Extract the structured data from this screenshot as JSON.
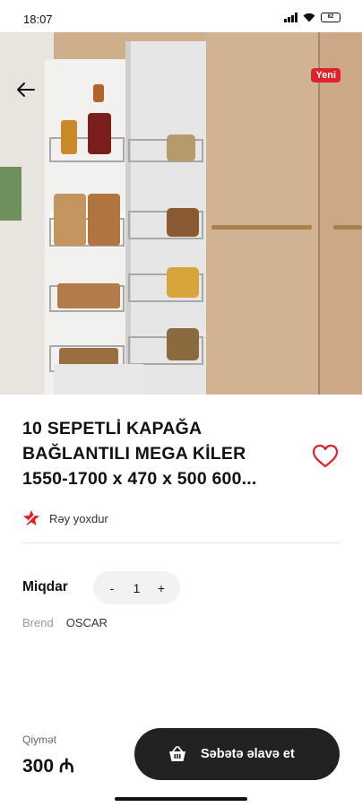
{
  "status_bar": {
    "time": "18:07",
    "battery": "82"
  },
  "hero": {
    "badge": "Yeni",
    "image_description": "Pull-out pantry cabinet with wire shelves"
  },
  "product": {
    "title_lines": [
      "10 SEPETLİ KAPAĞA",
      "BAĞLANTILI MEGA KİLER",
      "1550-1700 x 470 x 500 600..."
    ],
    "rating_text": "Rəy yoxdur"
  },
  "quantity": {
    "label": "Miqdar",
    "minus": "-",
    "value": "1",
    "plus": "+"
  },
  "brand": {
    "label": "Brend",
    "value": "OSCAR"
  },
  "price": {
    "label": "Qiymət",
    "value": "300 ₼"
  },
  "cart": {
    "label": "Səbətə əlavə et"
  },
  "colors": {
    "accent": "#e3202a",
    "button": "#222222"
  }
}
